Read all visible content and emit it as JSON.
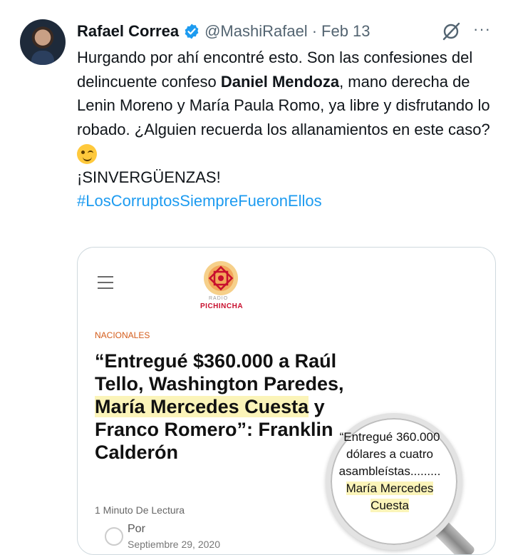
{
  "tweet": {
    "author_name": "Rafael Correa",
    "handle": "@MashiRafael",
    "separator": "·",
    "date": "Feb 13",
    "more": "···",
    "line_1": "Hurgando por ahí encontré esto. Son las confesiones del delincuente confeso ",
    "bold_name": "Daniel Mendoza",
    "line_2": ", mano derecha de Lenin Moreno y María Paula  Romo, ya libre y disfrutando lo robado.",
    "line_3": "¿Alguien recuerda los allanamientos en este caso?",
    "exclaim": "¡SINVERGÜENZAS!",
    "hashtag": "#LosCorruptosSiempreFueronEllos"
  },
  "card": {
    "logo_small": "RADIO",
    "logo_name": "PICHINCHA",
    "section": "NACIONALES",
    "headline_a": "“Entregué $360.000 a Raúl Tello, Washington Paredes, ",
    "headline_hl": "María Mercedes Cuesta",
    "headline_b": " y Franco Romero”: Franklin Calderón",
    "read_time": "1 Minuto De Lectura",
    "author": "Por",
    "pubdate": "Septiembre 29, 2020",
    "quote_text": "“Entregué 360.000 dólares a cuatro asambleístas.........",
    "quote_hl": "María Mercedes Cuesta"
  },
  "colors": {
    "link": "#1d9bf0",
    "secondary": "#536471",
    "highlight": "#fbf4b9",
    "brand_red": "#c8102e"
  }
}
